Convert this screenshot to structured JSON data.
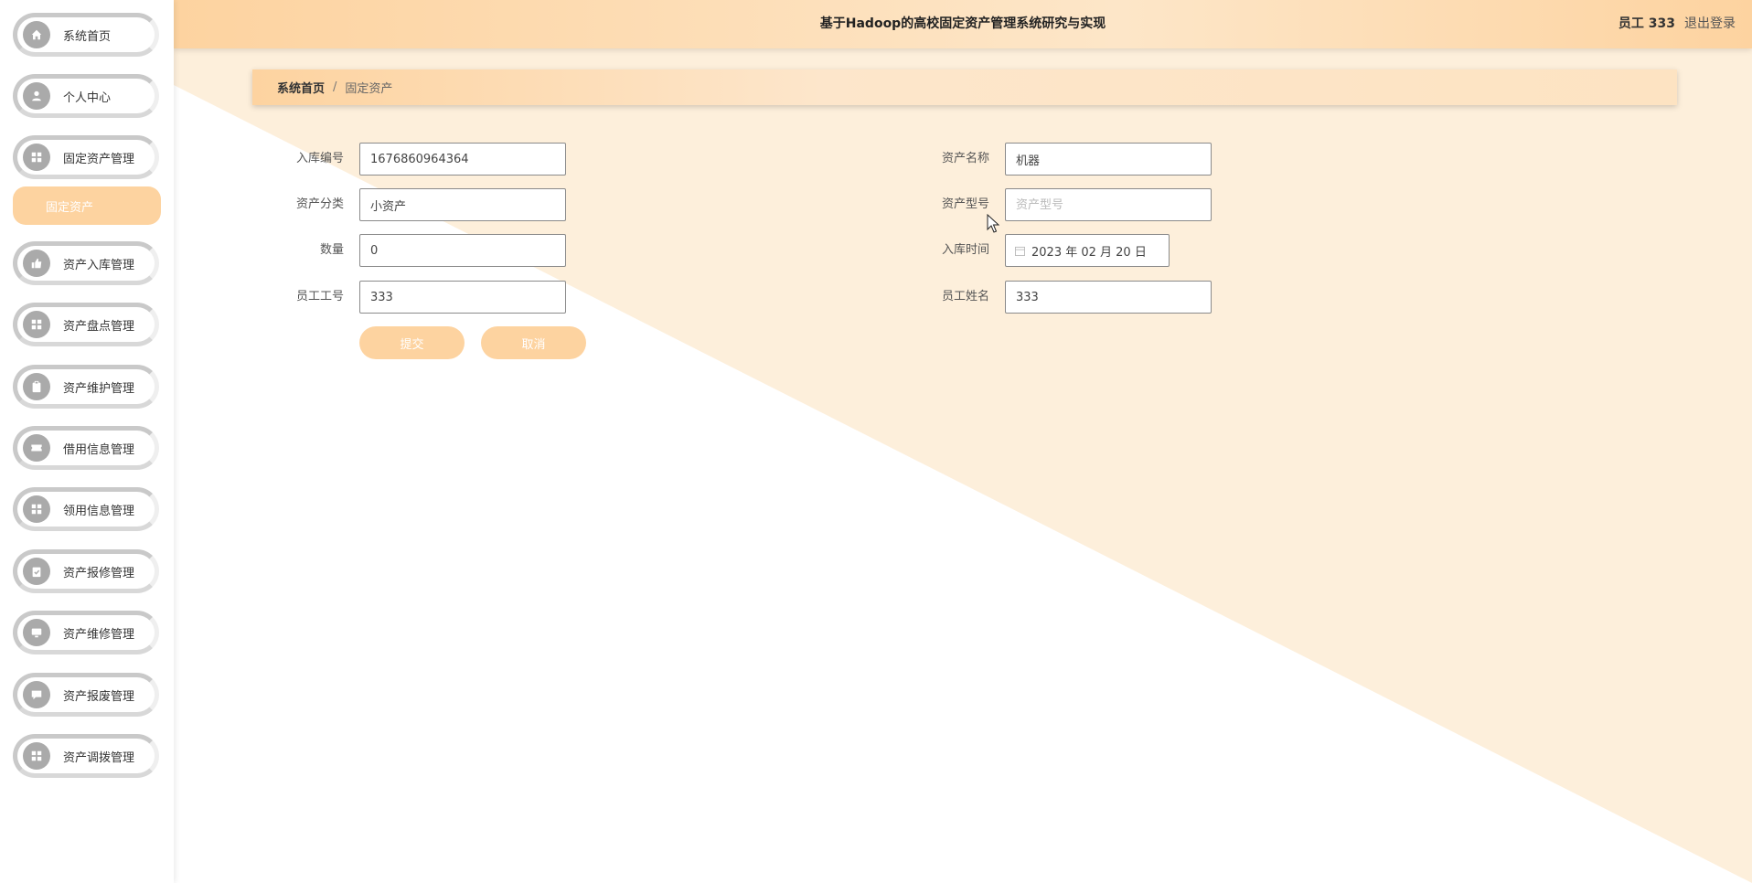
{
  "app": {
    "title": "基于Hadoop的高校固定资产管理系统研究与实现",
    "user_label": "员工 333",
    "logout_label": "退出登录"
  },
  "sidebar": {
    "items": [
      {
        "label": "系统首页",
        "icon": "home-icon"
      },
      {
        "label": "个人中心",
        "icon": "user-icon"
      },
      {
        "label": "固定资产管理",
        "icon": "grid-icon"
      },
      {
        "label": "资产入库管理",
        "icon": "thumbs-up-icon"
      },
      {
        "label": "资产盘点管理",
        "icon": "grid-icon"
      },
      {
        "label": "资产维护管理",
        "icon": "clipboard-icon"
      },
      {
        "label": "借用信息管理",
        "icon": "ticket-icon"
      },
      {
        "label": "领用信息管理",
        "icon": "grid-icon"
      },
      {
        "label": "资产报修管理",
        "icon": "clipboard-check-icon"
      },
      {
        "label": "资产维修管理",
        "icon": "monitor-icon"
      },
      {
        "label": "资产报废管理",
        "icon": "chat-icon"
      },
      {
        "label": "资产调拨管理",
        "icon": "grid-icon"
      }
    ],
    "submenu_active": "固定资产"
  },
  "breadcrumb": {
    "home": "系统首页",
    "separator": "/",
    "current": "固定资产"
  },
  "form": {
    "entry_no": {
      "label": "入库编号",
      "value": "1676860964364"
    },
    "asset_name": {
      "label": "资产名称",
      "value": "机器"
    },
    "asset_category": {
      "label": "资产分类",
      "value": "小资产"
    },
    "asset_model": {
      "label": "资产型号",
      "value": "",
      "placeholder": "资产型号"
    },
    "quantity": {
      "label": "数量",
      "value": "0"
    },
    "entry_time": {
      "label": "入库时间",
      "value": "2023 年 02 月 20 日"
    },
    "employee_no": {
      "label": "员工工号",
      "value": "333"
    },
    "employee_name": {
      "label": "员工姓名",
      "value": "333"
    },
    "submit_label": "提交",
    "cancel_label": "取消"
  },
  "colors": {
    "accent": "#fdd3a0",
    "background_tint": "#fdefdb",
    "icon_gray": "#aaaaaa"
  }
}
